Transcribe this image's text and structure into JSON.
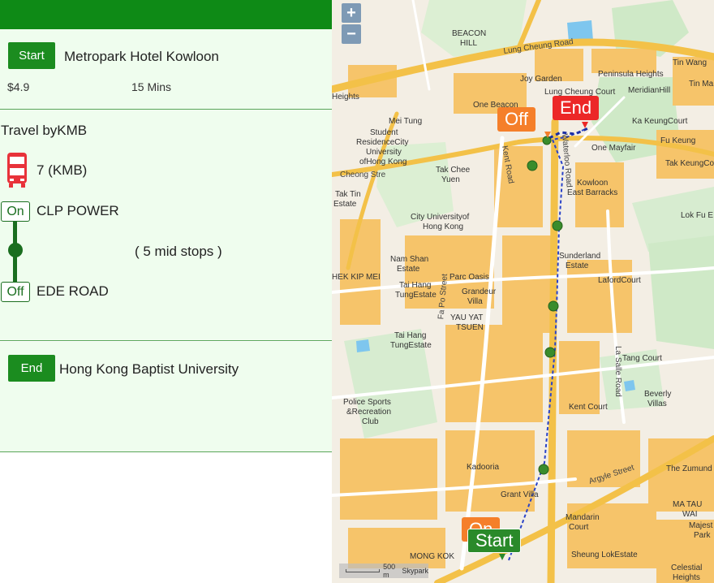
{
  "left_panel": {
    "start": {
      "button_label": "Start",
      "place": "Metropark Hotel Kowloon",
      "fare": "$4.9",
      "duration": "15 Mins"
    },
    "route": {
      "travel_by": "Travel byKMB",
      "bus_icon": "double-decker-bus-icon",
      "bus_route": "7 (KMB)",
      "on_label": "On",
      "on_stop": "CLP POWER",
      "mid_stops": "( 5 mid stops )",
      "off_label": "Off",
      "off_stop": "EDE ROAD"
    },
    "end": {
      "button_label": "End",
      "place": "Hong Kong Baptist University"
    }
  },
  "map": {
    "zoom_in": "+",
    "zoom_out": "−",
    "markers": {
      "start": "Start",
      "on": "On",
      "off": "Off",
      "end": "End"
    },
    "scale": {
      "label": "500 m",
      "attribution": "Skypark"
    },
    "labels": {
      "beacon_hill": "BEACON",
      "beacon_hill_2": "HILL",
      "lung_cheung_road": "Lung Cheung Road",
      "tin_wang": "Tin Wang",
      "peninsula_heights": "Peninsula Heights",
      "meridian_hill": "MeridianHill",
      "tin_ma_court": "Tin Ma Co",
      "joy_garden": "Joy Garden",
      "lung_cheung_court": "Lung Cheung Court",
      "one_beacon_hill": "One Beacon",
      "ka_keung_court": "Ka KeungCourt",
      "one_mayfair": "One Mayfair",
      "fu_keung_court": "Fu Keung",
      "tak_keung_court": "Tak KeungCour",
      "student_residence": "Student",
      "student_residence_2": "ResidenceCity",
      "student_residence_3": "University",
      "student_residence_4": "ofHong Kong",
      "tak_chee_yuen": "Tak Chee",
      "tak_chee_yuen_2": "Yuen",
      "kowloon_east_barracks": "Kowloon",
      "kowloon_east_barracks_2": "East Barracks",
      "city_university": "City Universityof",
      "city_university_2": "Hong Kong",
      "lok_fu": "Lok Fu E",
      "nam_shan_estate": "Nam Shan",
      "nam_shan_estate_2": "Estate",
      "sunderland_estate": "Sunderland",
      "sunderland_estate_2": "Estate",
      "laford_court": "LafordCourt",
      "parc_oasis": "Parc Oasis",
      "pak_kip_mei": "HEK KIP MEI",
      "tai_hang_tung_estate": "Tai Hang",
      "tai_hang_tung_estate_2": "TungEstate",
      "grandeur_villa": "Grandeur",
      "grandeur_villa_2": "Villa",
      "yau_yat_tsuen": "YAU YAT",
      "yau_yat_tsuen_2": "TSUEN",
      "tai_hang_tung_2": "Tai Hang",
      "tai_hang_tung_2b": "TungEstate",
      "tang_court": "Tang Court",
      "beverly_villas": "Beverly",
      "beverly_villas_2": "Villas",
      "police_sports": "Police Sports",
      "police_sports_2": "&Recreation",
      "police_sports_3": "Club",
      "kent_court": "Kent Court",
      "kadooria": "Kadooria",
      "grant_villa": "Grant Villa",
      "argyle_street": "Argyle Street",
      "the_zumunda": "The Zumund",
      "ma_tau_wai": "MA TAU",
      "ma_tau_wai_2": "WAI",
      "mandarin_court": "Mandarin",
      "mandarin_court_2": "Court",
      "majestic": "Majest",
      "majestic_2": "Park",
      "mong_kok": "MONG KOK",
      "sheung_lok_estate": "Sheung LokEstate",
      "celestial_heights": "Celestial",
      "celestial_heights_2": "Heights",
      "kent_road": "Kent Road",
      "waterloo_road": "Waterloo Road",
      "la_salle_road": "La Salle Road",
      "fa_po_street": "Fa Po Street",
      "tak_tin_estate": "Tak Tin",
      "tak_tin_estate_2": "Estate",
      "heights": "Heights",
      "mei_tung": "Mei Tung",
      "cheong_street": "Cheong Stre"
    }
  }
}
